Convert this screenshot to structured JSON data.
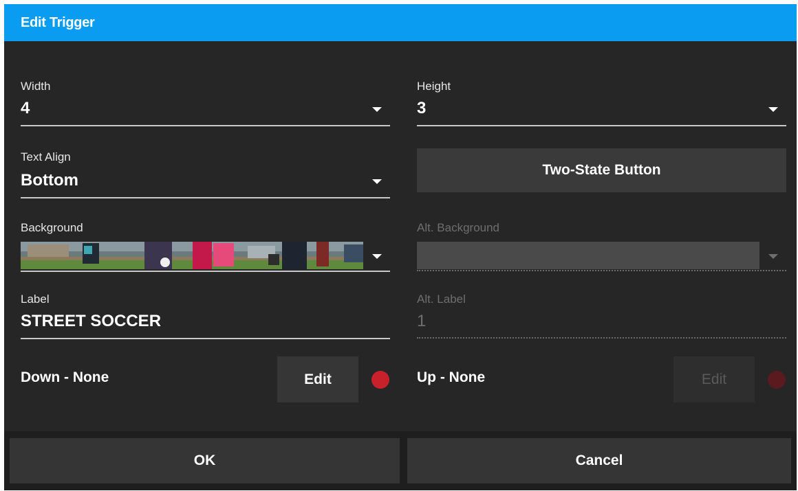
{
  "dialog": {
    "title": "Edit Trigger"
  },
  "width": {
    "label": "Width",
    "value": "4"
  },
  "height": {
    "label": "Height",
    "value": "3"
  },
  "text_align": {
    "label": "Text Align",
    "value": "Bottom"
  },
  "two_state_button": {
    "label": "Two-State Button"
  },
  "background": {
    "label": "Background"
  },
  "alt_background": {
    "label": "Alt. Background"
  },
  "label_field": {
    "label": "Label",
    "value": "STREET SOCCER"
  },
  "alt_label": {
    "label": "Alt. Label",
    "value": "1"
  },
  "down_action": {
    "label": "Down - None",
    "edit_label": "Edit",
    "status_color": "#c9212c"
  },
  "up_action": {
    "label": "Up - None",
    "edit_label": "Edit",
    "status_color": "#5a1a1e"
  },
  "footer": {
    "ok_label": "OK",
    "cancel_label": "Cancel"
  },
  "colors": {
    "title_bar": "#0a9cf0",
    "panel": "#262626",
    "button": "#363636"
  },
  "icons": {
    "dropdown": "triangle-down-icon",
    "status": "status-dot-icon"
  }
}
